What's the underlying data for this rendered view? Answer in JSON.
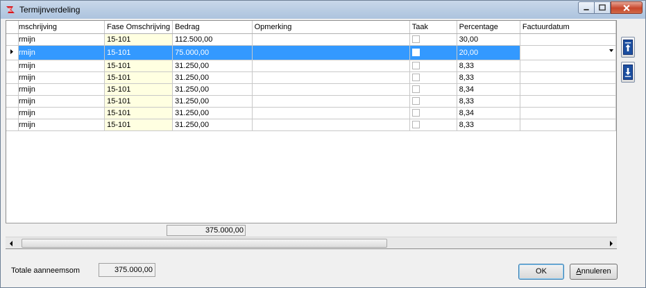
{
  "window": {
    "title": "Termijnverdeling"
  },
  "grid": {
    "columns": [
      {
        "key": "omschrijving",
        "label": "mschrijving"
      },
      {
        "key": "fase",
        "label": "Fase Omschrijving"
      },
      {
        "key": "bedrag",
        "label": "Bedrag"
      },
      {
        "key": "opmerking",
        "label": "Opmerking"
      },
      {
        "key": "taak",
        "label": "Taak"
      },
      {
        "key": "percentage",
        "label": "Percentage"
      },
      {
        "key": "factuurdatum",
        "label": "Factuurdatum"
      }
    ],
    "rows": [
      {
        "omschrijving": "rmijn",
        "fase": "15-101",
        "bedrag": "112.500,00",
        "opmerking": "",
        "taak": false,
        "percentage": "30,00",
        "factuurdatum": "",
        "selected": false
      },
      {
        "omschrijving": "rmijn",
        "fase": "15-101",
        "bedrag": "75.000,00",
        "opmerking": "",
        "taak": false,
        "percentage": "20,00",
        "factuurdatum": "",
        "selected": true
      },
      {
        "omschrijving": "rmijn",
        "fase": "15-101",
        "bedrag": "31.250,00",
        "opmerking": "",
        "taak": false,
        "percentage": "8,33",
        "factuurdatum": "",
        "selected": false
      },
      {
        "omschrijving": "rmijn",
        "fase": "15-101",
        "bedrag": "31.250,00",
        "opmerking": "",
        "taak": false,
        "percentage": "8,33",
        "factuurdatum": "",
        "selected": false
      },
      {
        "omschrijving": "rmijn",
        "fase": "15-101",
        "bedrag": "31.250,00",
        "opmerking": "",
        "taak": false,
        "percentage": "8,34",
        "factuurdatum": "",
        "selected": false
      },
      {
        "omschrijving": "rmijn",
        "fase": "15-101",
        "bedrag": "31.250,00",
        "opmerking": "",
        "taak": false,
        "percentage": "8,33",
        "factuurdatum": "",
        "selected": false
      },
      {
        "omschrijving": "rmijn",
        "fase": "15-101",
        "bedrag": "31.250,00",
        "opmerking": "",
        "taak": false,
        "percentage": "8,34",
        "factuurdatum": "",
        "selected": false
      },
      {
        "omschrijving": "rmijn",
        "fase": "15-101",
        "bedrag": "31.250,00",
        "opmerking": "",
        "taak": false,
        "percentage": "8,33",
        "factuurdatum": "",
        "selected": false
      }
    ],
    "footer_total": "375.000,00"
  },
  "summary": {
    "label": "Totale aanneemsom",
    "value": "375.000,00"
  },
  "buttons": {
    "ok": "OK",
    "cancel_underline": "A",
    "cancel_rest": "nnuleren"
  },
  "icons": {
    "app": "app-logo-icon",
    "move_up": "move-up-icon",
    "move_down": "move-down-icon",
    "row_indicator": "row-pointer-icon",
    "dropdown": "chevron-down-icon"
  },
  "colors": {
    "selection": "#3399ff",
    "fase_column": "#ffffe1",
    "close_button": "#c8462c"
  }
}
